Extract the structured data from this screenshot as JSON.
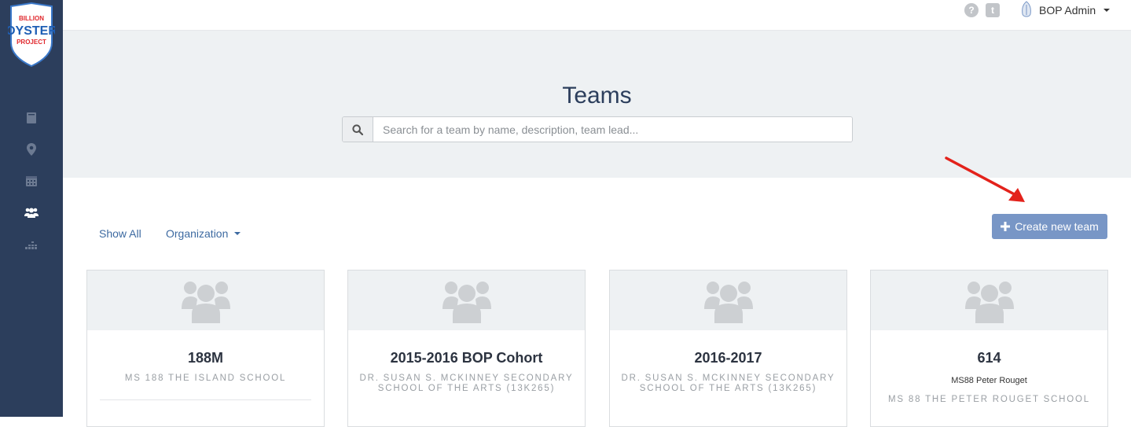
{
  "brand": {
    "line1": "BILLION",
    "line2": "OYSTER",
    "line3": "PROJECT"
  },
  "sidebar": {
    "items": [
      {
        "icon": "book-icon"
      },
      {
        "icon": "map-marker-icon"
      },
      {
        "icon": "calendar-icon"
      },
      {
        "icon": "users-icon",
        "active": true
      },
      {
        "icon": "chart-icon"
      }
    ]
  },
  "topbar": {
    "help_icon": "question-icon",
    "tumblr_icon": "tumblr-icon",
    "help_glyph": "?",
    "tumblr_glyph": "t",
    "user_name": "BOP Admin"
  },
  "hero": {
    "title": "Teams",
    "search_placeholder": "Search for a team by name, description, team lead..."
  },
  "filters": {
    "show_all": "Show All",
    "organization": "Organization"
  },
  "create_button": {
    "icon": "plus-icon",
    "label": "Create new team"
  },
  "colors": {
    "sidebar": "#2c3e5c",
    "hero": "#eef1f3",
    "link": "#3d6aa1",
    "button": "#7896c6",
    "annotation_arrow": "#e3221b"
  },
  "teams": [
    {
      "name": "188M",
      "lead": "",
      "organization": "MS 188 THE ISLAND SCHOOL"
    },
    {
      "name": "2015-2016 BOP Cohort",
      "lead": "",
      "organization": "DR. SUSAN S. MCKINNEY SECONDARY SCHOOL OF THE ARTS (13K265)"
    },
    {
      "name": "2016-2017",
      "lead": "",
      "organization": "DR. SUSAN S. MCKINNEY SECONDARY SCHOOL OF THE ARTS (13K265)"
    },
    {
      "name": "614",
      "lead": "MS88 Peter Rouget",
      "organization": "MS 88 THE PETER ROUGET SCHOOL"
    }
  ]
}
